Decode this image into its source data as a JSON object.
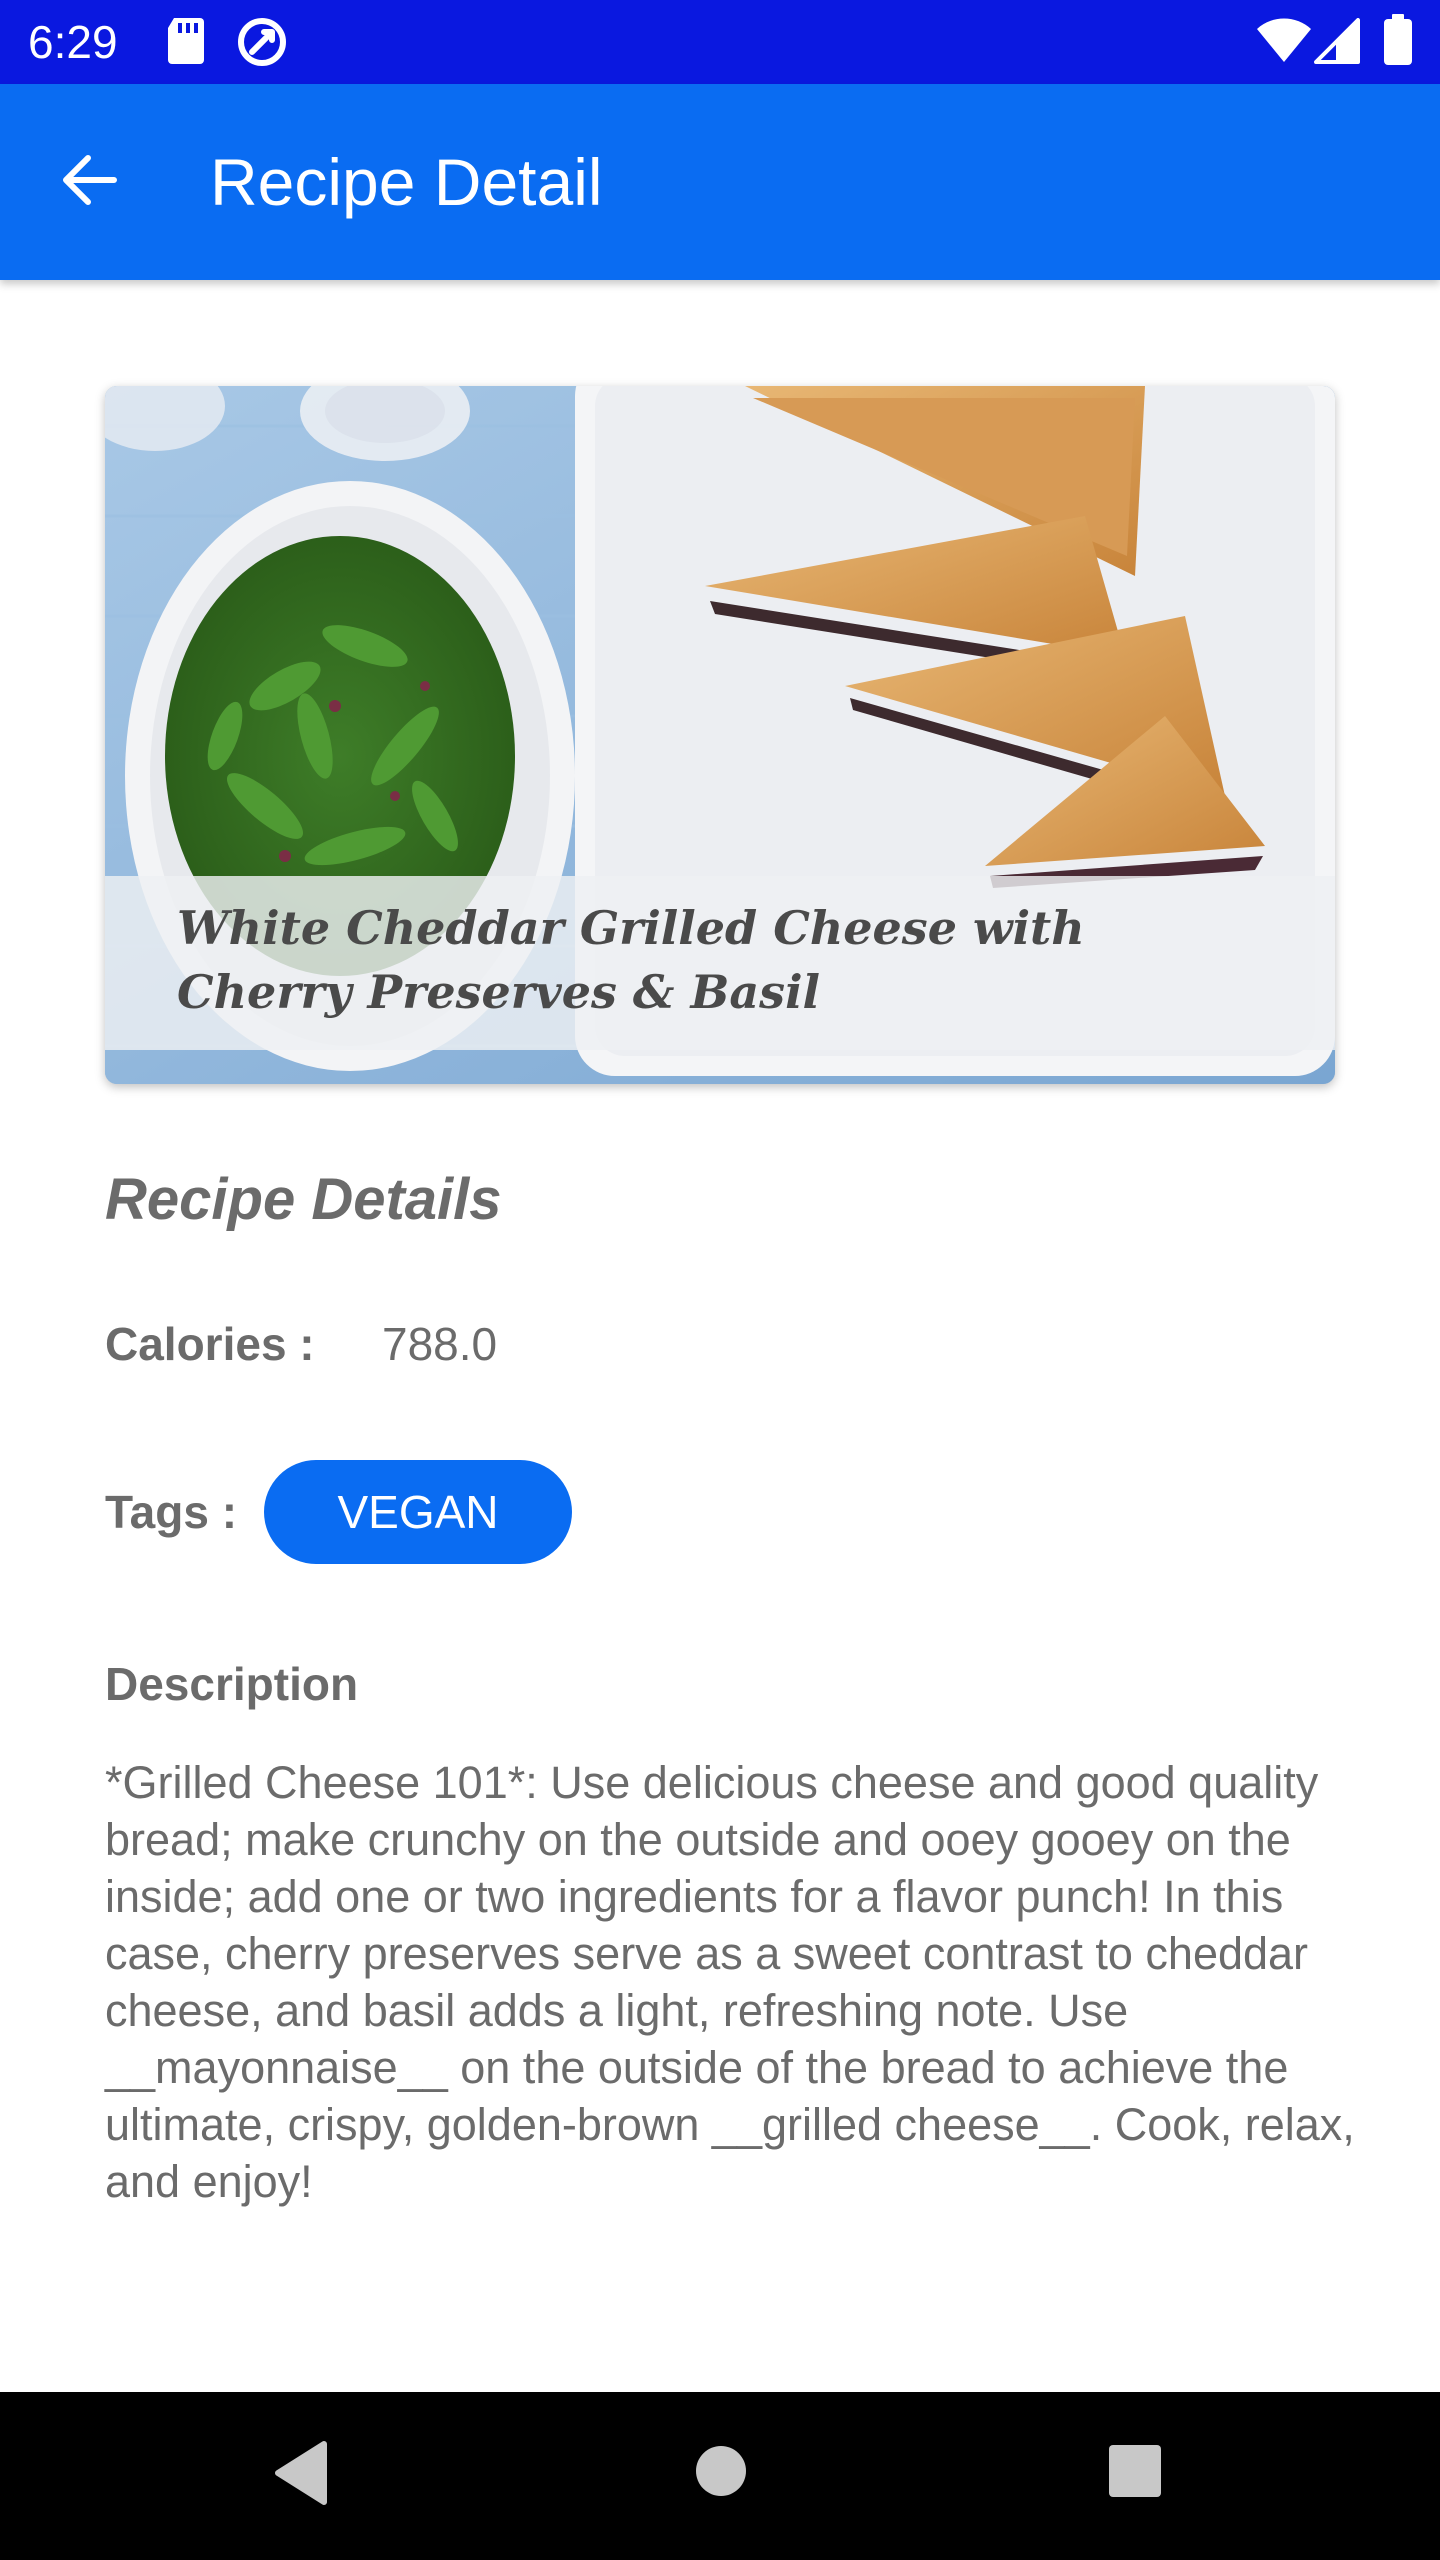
{
  "status_bar": {
    "time": "6:29",
    "icons": [
      "sd-card-icon",
      "sync-icon",
      "wifi-icon",
      "signal-icon",
      "battery-icon"
    ],
    "color": "#0a18e0"
  },
  "app_bar": {
    "title": "Recipe Detail",
    "back_icon": "arrow-back-icon",
    "color": "#0a6cf2"
  },
  "recipe": {
    "title": "White Cheddar Grilled Cheese with Cherry Preserves & Basil",
    "section_heading": "Recipe Details",
    "calories_label": "Calories :",
    "calories_value": "788.0",
    "tags_label": "Tags :",
    "tags": [
      "VEGAN"
    ],
    "description_heading": "Description",
    "description": "*Grilled Cheese 101*: Use delicious cheese and good quality bread; make crunchy on the outside and ooey gooey on the inside; add one or two ingredients for a flavor punch! In this case, cherry preserves serve as a sweet contrast to cheddar cheese, and basil adds a light, refreshing note. Use __mayonnaise__ on the outside of the bread to achieve the ultimate, crispy, golden-brown __grilled cheese__. Cook, relax, and enjoy!"
  },
  "nav_bar": {
    "buttons": [
      "back-triangle-icon",
      "home-circle-icon",
      "recents-square-icon"
    ]
  },
  "colors": {
    "accent": "#0a6cf2",
    "text_secondary": "#6b6b6b"
  }
}
